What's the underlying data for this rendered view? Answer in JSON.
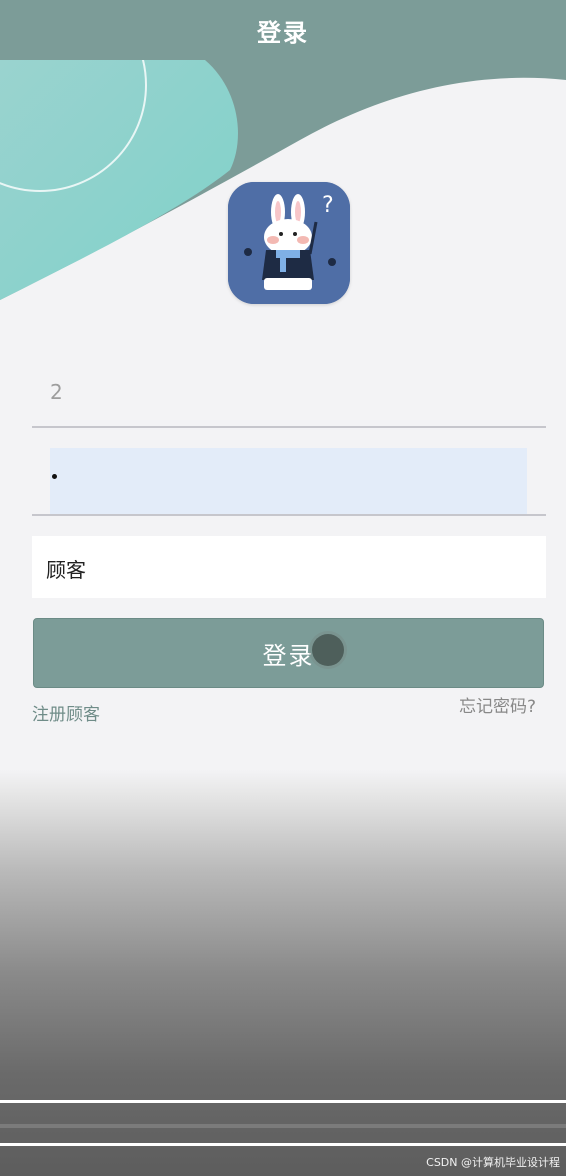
{
  "navbar": {
    "title": "登录"
  },
  "form": {
    "account_value": "2",
    "role_value": "顾客",
    "login_label": "登录",
    "register_link": "注册顾客",
    "forgot_link": "忘记密码?"
  },
  "watermark": "CSDN @计算机毕业设计程",
  "colors": {
    "accent": "#7c9c98",
    "logo_bg": "#4f6ea6",
    "password_bg": "#e3ecf9"
  }
}
